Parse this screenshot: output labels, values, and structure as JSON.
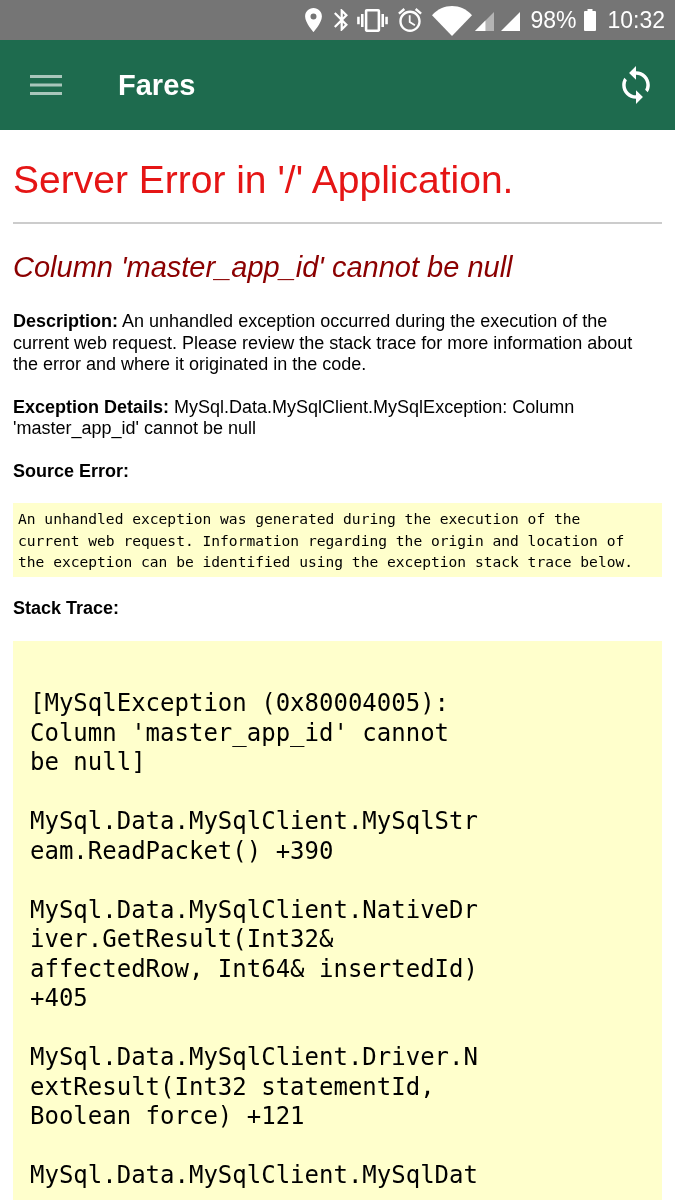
{
  "status_bar": {
    "battery": "98%",
    "time": "10:32"
  },
  "app_bar": {
    "title": "Fares"
  },
  "page": {
    "title": "Server Error in '/' Application.",
    "error_message": "Column 'master_app_id' cannot be null",
    "description": "**Description:** An unhandled exception occurred during the execution of the current web request. Please review the stack trace for more information about the error and where it originated in the code.",
    "exception_details": "**Exception Details:** MySql.Data.MySqlClient.MySqlException: Column 'master_app_id' cannot be null",
    "source_error": {
      "label": "Source Error:",
      "text": "An unhandled exception was generated during the execution of the current web request. Information regarding the origin and location of the exception can be identified using the exception stack trace below."
    },
    "stack_trace": {
      "label": "Stack Trace:",
      "entries": [
        "[MySqlException (0x80004005): Column 'master_app_id' cannot be null]",
        "MySql.Data.MySqlClient.MySqlStream.ReadPacket() +390",
        "MySql.Data.MySqlClient.NativeDriver.GetResult(Int32& affectedRow, Int64& insertedId) +405",
        "MySql.Data.MySqlClient.Driver.NextResult(Int32 statementId, Boolean force) +121",
        "MySql.Data.MySqlClient.MySqlDat"
      ]
    }
  }
}
